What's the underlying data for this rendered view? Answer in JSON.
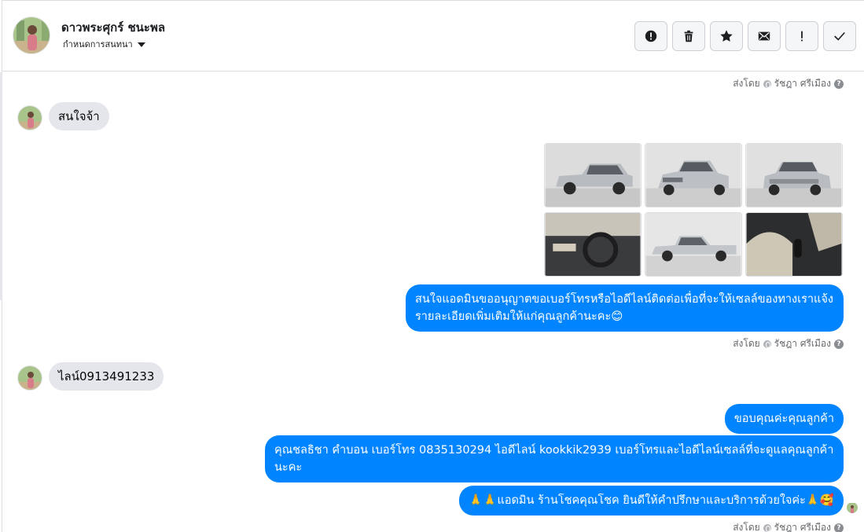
{
  "header": {
    "contact_name": "ดาวพระศุกร์ ชนะพล",
    "assign_label": "กำหนดการสนทนา",
    "actions": [
      {
        "name": "spam-button",
        "icon": "alert-circle-icon"
      },
      {
        "name": "delete-button",
        "icon": "trash-icon"
      },
      {
        "name": "star-button",
        "icon": "star-icon"
      },
      {
        "name": "mark-unread-button",
        "icon": "envelope-icon"
      },
      {
        "name": "follow-up-button",
        "icon": "exclamation-icon"
      },
      {
        "name": "done-button",
        "icon": "checkmark-icon"
      }
    ]
  },
  "sender_attribution": {
    "prefix": "ส่งโดย",
    "name": "รัชฎา ศรีเมือง"
  },
  "messages": [
    {
      "direction": "incoming",
      "text": "สนใจจ้า"
    },
    {
      "direction": "outgoing",
      "type": "photos",
      "count": 6
    },
    {
      "direction": "outgoing",
      "text": "สนใจแอดมินขออนุญาตขอเบอร์โทรหรือไอดีไลน์ติดต่อเพื่อที่จะให้เซลล์ของทางเราแจ้งรายละเอียดเพิ่มเติมให้แก่คุณลูกค้านะคะ😊"
    },
    {
      "direction": "incoming",
      "text": "ไลน์0913491233"
    },
    {
      "direction": "outgoing",
      "text": "ขอบคุณค่ะคุณลูกค้า"
    },
    {
      "direction": "outgoing",
      "text": "คุณชลธิชา คำบอน เบอร์โทร 0835130294  ไอดีไลน์ kookkik2939   เบอร์โทรและไอดีไลน์เซลล์ที่จะดูแลคุณลูกค้านะคะ"
    },
    {
      "direction": "outgoing",
      "text": "🙏🙏แอดมิน ร้านโชคคุณโชค ยินดีให้คำปรึกษาและบริการด้วยใจค่ะ🙏🥰"
    }
  ],
  "colors": {
    "outgoing_bubble": "#0084ff",
    "incoming_bubble": "#e4e6eb",
    "meta_text": "#65676b"
  }
}
